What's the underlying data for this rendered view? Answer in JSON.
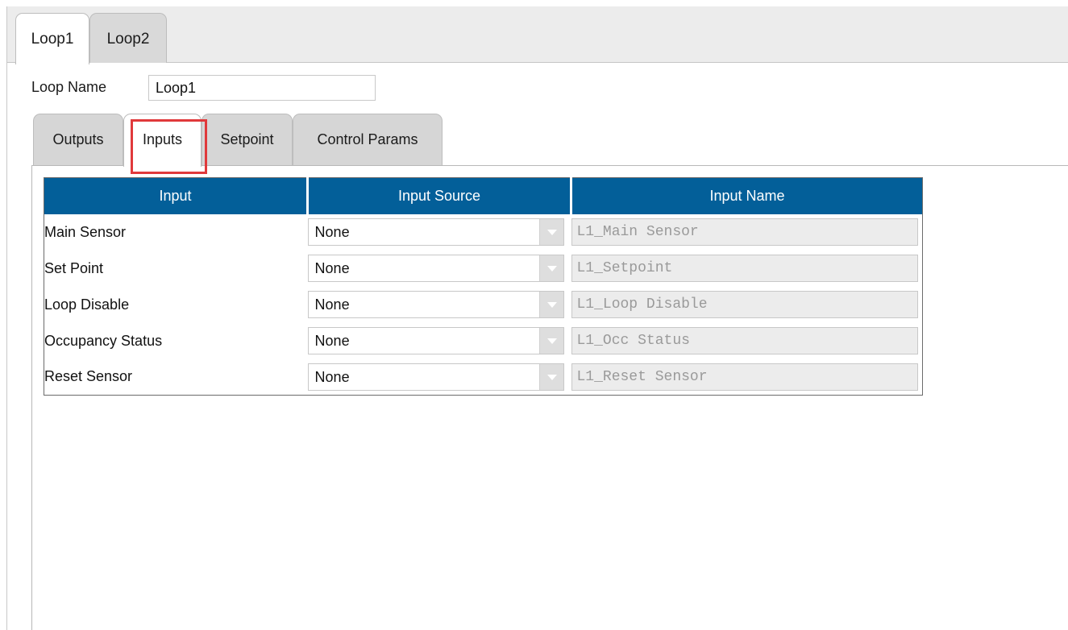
{
  "loop_tabs": [
    "Loop1",
    "Loop2"
  ],
  "loop_name": {
    "label": "Loop Name",
    "value": "Loop1"
  },
  "inner_tabs": [
    "Outputs",
    "Inputs",
    "Setpoint",
    "Control Params"
  ],
  "table": {
    "headers": [
      "Input",
      "Input Source",
      "Input Name"
    ],
    "rows": [
      {
        "input": "Main Sensor",
        "source": "None",
        "name": "L1_Main Sensor"
      },
      {
        "input": "Set Point",
        "source": "None",
        "name": "L1_Setpoint"
      },
      {
        "input": "Loop Disable",
        "source": "None",
        "name": "L1_Loop Disable"
      },
      {
        "input": "Occupancy Status",
        "source": "None",
        "name": "L1_Occ Status"
      },
      {
        "input": "Reset Sensor",
        "source": "None",
        "name": "L1_Reset Sensor"
      }
    ]
  },
  "colors": {
    "header_bg": "#035f99",
    "highlight": "#e0393b"
  },
  "icons": {
    "dropdown": "chevron-down-icon"
  }
}
